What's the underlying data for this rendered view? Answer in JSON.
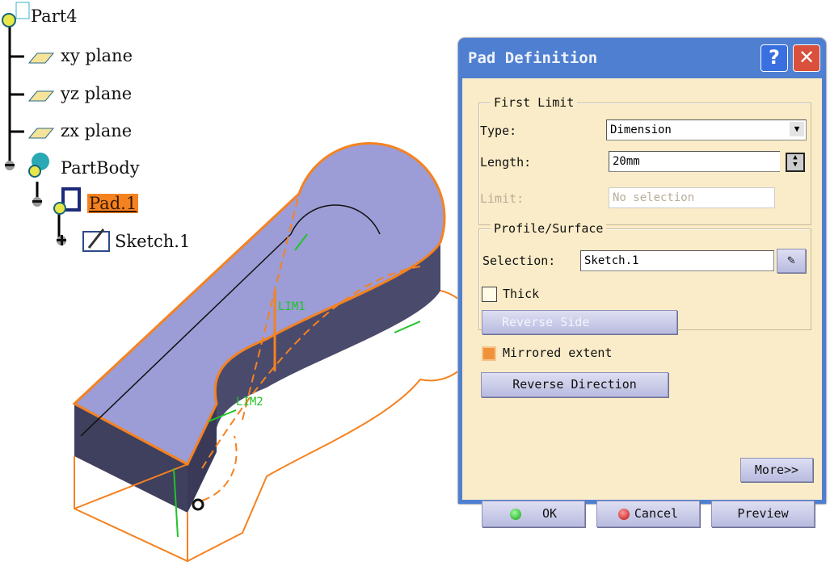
{
  "tree": {
    "root": "Part4",
    "items": [
      {
        "label": "xy plane",
        "icon": "plane-icon"
      },
      {
        "label": "yz plane",
        "icon": "plane-icon"
      },
      {
        "label": "zx plane",
        "icon": "plane-icon"
      },
      {
        "label": "PartBody",
        "icon": "body-icon"
      },
      {
        "label": "Pad.1",
        "icon": "pad-icon",
        "selected": true
      },
      {
        "label": "Sketch.1",
        "icon": "sketch-icon"
      }
    ]
  },
  "viewport": {
    "limit1": "LIM1",
    "limit2": "LIM2",
    "model_color": "#9c9cd6",
    "wire_color": "#f58220"
  },
  "dialog": {
    "title": "Pad Definition",
    "help": "?",
    "close": "✕",
    "first_limit": {
      "legend": "First Limit",
      "type_label": "Type:",
      "type_value": "Dimension",
      "length_label": "Length:",
      "length_value": "20mm",
      "limit_label": "Limit:",
      "limit_value": "No selection"
    },
    "profile": {
      "legend": "Profile/Surface",
      "selection_label": "Selection:",
      "selection_value": "Sketch.1",
      "thick_label": "Thick",
      "thick_checked": false,
      "reverse_side": "Reverse Side"
    },
    "mirrored_label": "Mirrored extent",
    "mirrored_checked": true,
    "reverse_direction": "Reverse Direction",
    "more": "More>>",
    "ok": "OK",
    "cancel": "Cancel",
    "preview": "Preview"
  }
}
